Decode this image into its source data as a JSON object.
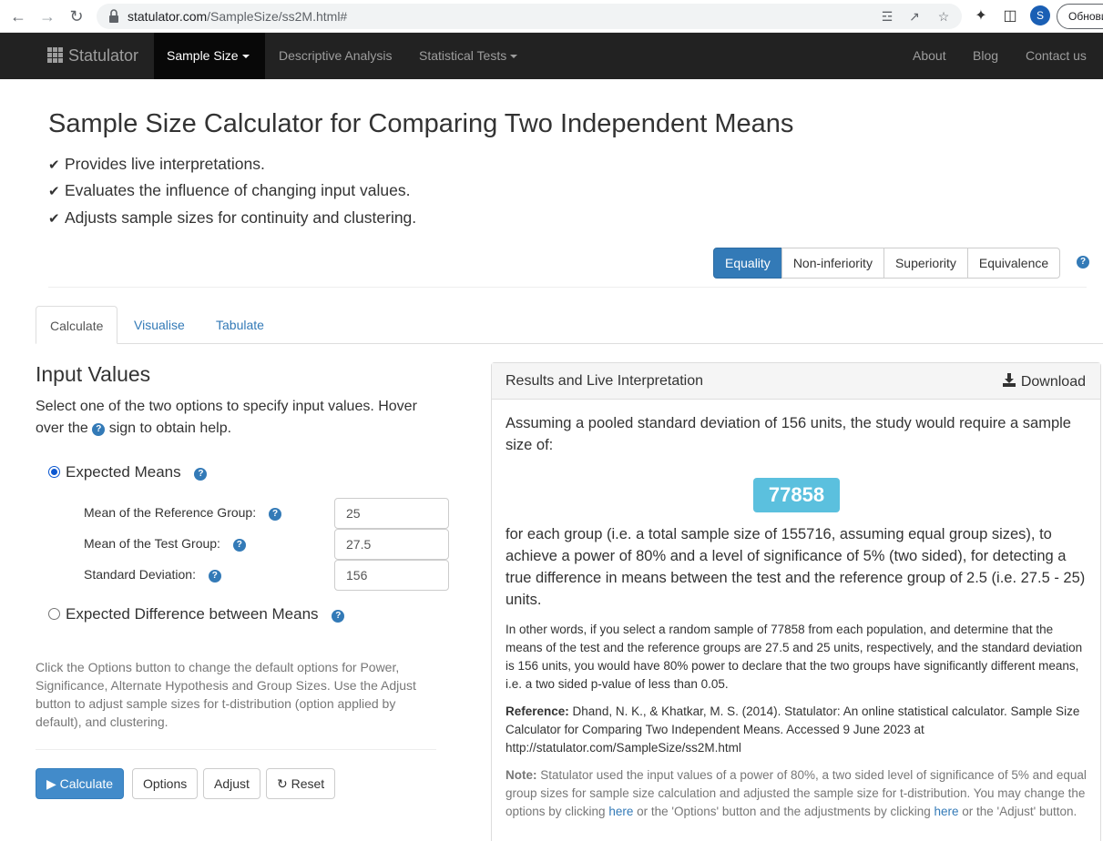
{
  "browser": {
    "url_host": "statulator.com",
    "url_path": "/SampleSize/ss2M.html#",
    "profile_initial": "S",
    "update_label": "Обнови"
  },
  "navbar": {
    "brand": "Statulator",
    "items": [
      {
        "label": "Sample Size",
        "active": true,
        "dropdown": true
      },
      {
        "label": "Descriptive Analysis"
      },
      {
        "label": "Statistical Tests",
        "dropdown": true
      }
    ],
    "right_items": [
      "About",
      "Blog",
      "Contact us"
    ]
  },
  "header": {
    "title": "Sample Size Calculator for Comparing Two Independent Means",
    "features": [
      "Provides live interpretations.",
      "Evaluates the influence of changing input values.",
      "Adjusts sample sizes for continuity and clustering."
    ]
  },
  "test_types": {
    "options": [
      "Equality",
      "Non-inferiority",
      "Superiority",
      "Equivalence"
    ],
    "selected": "Equality"
  },
  "tabs": {
    "items": [
      "Calculate",
      "Visualise",
      "Tabulate"
    ],
    "active": "Calculate"
  },
  "input": {
    "heading": "Input Values",
    "lead_before": "Select one of the two options to specify input values. Hover over the",
    "lead_after": "sign to obtain help.",
    "option1": "Expected Means",
    "option2": "Expected Difference between Means",
    "selected_option": "Expected Means",
    "fields": [
      {
        "label": "Mean of the Reference Group:",
        "value": "25"
      },
      {
        "label": "Mean of the Test Group:",
        "value": "27.5"
      },
      {
        "label": "Standard Deviation:",
        "value": "156"
      }
    ],
    "help_text": "Click the Options button to change the default options for Power, Significance, Alternate Hypothesis and Group Sizes. Use the Adjust button to adjust sample sizes for t-distribution (option applied by default), and clustering."
  },
  "buttons": {
    "calculate": "Calculate",
    "options": "Options",
    "adjust": "Adjust",
    "reset": "Reset"
  },
  "results": {
    "title": "Results and Live Interpretation",
    "download": "Download",
    "intro": "Assuming a pooled standard deviation of 156 units, the study would require a sample size of:",
    "sample_size": "77858",
    "body": "for each group (i.e. a total sample size of 155716, assuming equal group sizes), to achieve a power of 80% and a level of significance of 5% (two sided), for detecting a true difference in means between the test and the reference group of 2.5 (i.e. 27.5 - 25) units.",
    "other_words": "In other words, if you select a random sample of 77858 from each population, and determine that the means of the test and the reference groups are 27.5 and 25 units, respectively, and the standard deviation is 156 units, you would have 80% power to declare that the two groups have significantly different means, i.e. a two sided p-value of less than 0.05.",
    "reference_label": "Reference:",
    "reference_text": "Dhand, N. K., & Khatkar, M. S. (2014). Statulator: An online statistical calculator. Sample Size Calculator for Comparing Two Independent Means. Accessed 9 June 2023 at http://statulator.com/SampleSize/ss2M.html",
    "note_label": "Note:",
    "note_part1": "Statulator used the input values of a power of 80%, a two sided level of significance of 5% and equal group sizes for sample size calculation and adjusted the sample size for t-distribution. You may change the options by clicking",
    "note_link1": "here",
    "note_part2": "or the 'Options' button and the adjustments by clicking",
    "note_link2": "here",
    "note_part3": "or the 'Adjust' button."
  },
  "colors": {
    "primary": "#337ab7",
    "navbar_bg": "#222222",
    "badge_bg": "#5bc0de"
  }
}
